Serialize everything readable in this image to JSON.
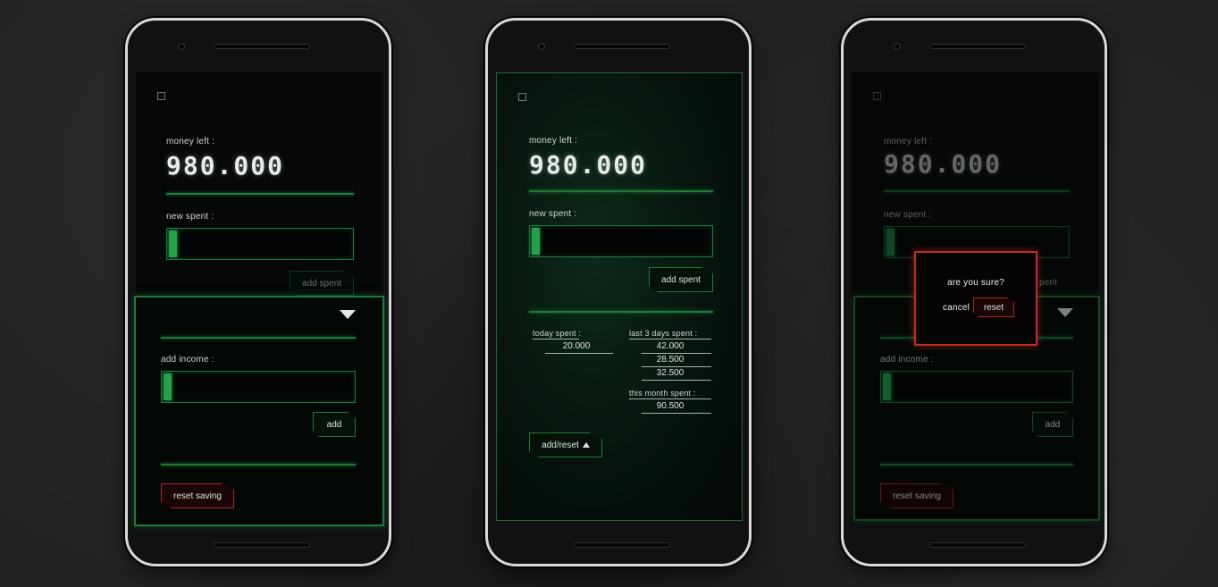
{
  "screens": {
    "a": {
      "money_left_label": "money left :",
      "money_left_value": "980.000",
      "new_spent_label": "new spent :",
      "add_spent_btn": "add spent",
      "add_income_label": "add income :",
      "add_btn": "add",
      "reset_saving_btn": "reset saving"
    },
    "b": {
      "money_left_label": "money left :",
      "money_left_value": "980.000",
      "new_spent_label": "new spent :",
      "add_spent_btn": "add spent",
      "today_spent_label": "today spent :",
      "today_spent_value": "20.000",
      "last3_label": "last 3 days spent :",
      "last3_values": [
        "42.000",
        "28.500",
        "32.500"
      ],
      "month_label": "this month spent :",
      "month_value": "90.500",
      "add_reset_btn": "add/reset"
    },
    "c": {
      "money_left_label": "money left :",
      "money_left_value": "980.000",
      "new_spent_label": "new spent :",
      "add_spent_partial": "pent",
      "add_income_label": "add income :",
      "add_btn": "add",
      "reset_saving_btn": "reset saving",
      "confirm_text": "are you sure?",
      "cancel_btn": "cancel",
      "reset_btn": "reset"
    }
  },
  "colors": {
    "accent_green": "#1f7a3e",
    "nub_green": "#23a24b",
    "danger_red": "#b02525"
  }
}
